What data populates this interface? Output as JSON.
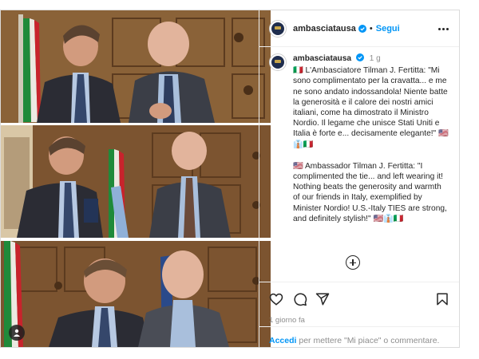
{
  "header": {
    "username": "ambasciatausa",
    "separator": "•",
    "follow_label": "Segui"
  },
  "caption": {
    "username": "ambasciatausa",
    "time_short": "1 g",
    "italian": "🇮🇹 L'Ambasciatore Tilman J. Fertitta: \"Mi sono complimentato per la cravatta... e me ne sono andato indossandola! Niente batte la generosità e il calore dei nostri amici italiani, come ha dimostrato il Ministro Nordio. Il legame che unisce Stati Uniti e Italia è forte e... decisamente elegante!\" 🇺🇸👔🇮🇹",
    "english": "🇺🇸 Ambassador Tilman J. Fertitta: \"I complimented the tie... and left wearing it! Nothing beats the generosity and warmth of our friends in Italy, exemplified by Minister Nordio! U.S.-Italy TIES are strong, and definitely stylish!\" 🇺🇸👔🇮🇹"
  },
  "footer": {
    "time_long": "1 giorno fa",
    "login_link": "Accedi",
    "login_text": " per mettere \"Mi piace\" o commentare."
  },
  "icons": {
    "more": "more-options-icon",
    "verified": "verified-badge-icon",
    "like": "heart-icon",
    "comment": "comment-icon",
    "share": "share-icon",
    "save": "bookmark-icon",
    "load_more": "plus-circle-icon",
    "tag": "user-tag-icon"
  },
  "colors": {
    "accent": "#0095f6",
    "text": "#262626",
    "muted": "#8e8e8e",
    "border": "#dbdbdb"
  }
}
